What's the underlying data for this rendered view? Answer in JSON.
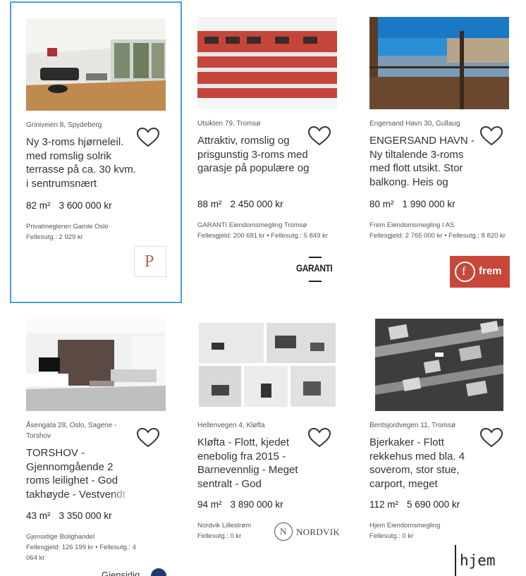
{
  "listings": [
    {
      "location": "Griniveien 8, Spydeberg",
      "title": "Ny 3-roms hjørneleil. med romslig solrik terrasse på ca. 30 kvm. i sentrumsnært",
      "area": "82 m²",
      "price": "3 600 000 kr",
      "broker": "Privatmegleren Gamle Oslo",
      "fees": "Fellesutg.: 2 929 kr",
      "logo_icon": "privatmegleren-logo",
      "logo_text": "P"
    },
    {
      "location": "Utsikten 79, Tromsø",
      "title": "Attraktiv, romslig og prisgunstig 3-roms med garasje på populære og",
      "area": "88 m²",
      "price": "2 450 000 kr",
      "broker": "GARANTI Eiendomsmegling Tromsø",
      "fees": "Fellesgjeld: 200 681 kr • Fellesutg.: 5 849 kr",
      "logo_icon": "garanti-logo",
      "logo_text": "GARANTI"
    },
    {
      "location": "Engersand Havn 30, Gullaug",
      "title": "ENGERSAND HAVN - Ny tiltalende 3-roms med flott utsikt. Stor balkong. Heis og",
      "area": "80 m²",
      "price": "1 990 000 kr",
      "broker": "Frem Eiendomsmegling I AS",
      "fees": "Fellesgjeld: 2 765 000 kr • Fellesutg.: 8 820 kr",
      "logo_icon": "frem-logo",
      "logo_text": "frem"
    },
    {
      "location": "Åsengata 28, Oslo, Sagene - Torshov",
      "title": "TORSHOV - Gjennomgående 2 roms leilighet - God takhøyde - Vestvendt",
      "area": "43 m²",
      "price": "3 350 000 kr",
      "broker": "Gjensidige Bolighandel",
      "fees": "Fellesgjeld: 126 199 kr • Fellesutg.: 4 064 kr",
      "logo_icon": "gjensidige-logo",
      "logo_text": "Gjensidig"
    },
    {
      "location": "Hellenvegen 4, Kløfta",
      "title": "Kløfta - Flott, kjedet enebolig fra 2015 - Barnevennlig - Meget sentralt - God",
      "area": "94 m²",
      "price": "3 890 000 kr",
      "broker": "Nordvik Lillestrøm",
      "fees": "Fellesutg.: 0 kr",
      "logo_icon": "nordvik-logo",
      "logo_text": "NORDVIK"
    },
    {
      "location": "Bentsjordvegen 11, Tromsø",
      "title": "Bjerkaker - Flott rekkehus med bla. 4 soverom, stor stue, carport, meget",
      "area": "112 m²",
      "price": "5 690 000 kr",
      "broker": "Hjem Eiendomsmegling",
      "fees": "Fellesutg.: 0 kr",
      "logo_icon": "hjem-logo",
      "logo_text": "hjem"
    }
  ],
  "icons": {
    "favorite": "heart-outline-icon"
  },
  "colors": {
    "selected_border": "#4a9fd8",
    "frem_brand": "#c8473a",
    "text": "#333333"
  }
}
